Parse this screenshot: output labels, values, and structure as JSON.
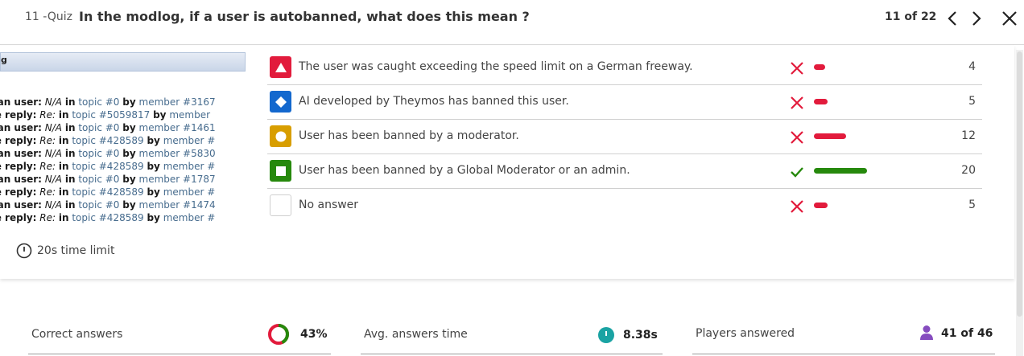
{
  "header": {
    "quiz_label": "11 -Quiz",
    "question": "In the modlog, if a user is autobanned, what does this mean ?",
    "counter": "11 of 22"
  },
  "modlog": {
    "header_text": "g",
    "lines": [
      {
        "action": "ban user:",
        "subject": "N/A",
        "mid": "in",
        "topic": "topic #0",
        "by": "by",
        "member": "member #3167"
      },
      {
        "action": "te reply:",
        "subject": "Re:",
        "mid": "in",
        "topic": "topic #5059817",
        "by": "by",
        "member": "member"
      },
      {
        "action": "ban user:",
        "subject": "N/A",
        "mid": "in",
        "topic": "topic #0",
        "by": "by",
        "member": "member #1461"
      },
      {
        "action": "te reply:",
        "subject": "Re:",
        "mid": "in",
        "topic": "topic #428589",
        "by": "by",
        "member": "member #"
      },
      {
        "action": "ban user:",
        "subject": "N/A",
        "mid": "in",
        "topic": "topic #0",
        "by": "by",
        "member": "member #5830"
      },
      {
        "action": "te reply:",
        "subject": "Re:",
        "mid": "in",
        "topic": "topic #428589",
        "by": "by",
        "member": "member #"
      },
      {
        "action": "ban user:",
        "subject": "N/A",
        "mid": "in",
        "topic": "topic #0",
        "by": "by",
        "member": "member #1787"
      },
      {
        "action": "te reply:",
        "subject": "Re:",
        "mid": "in",
        "topic": "topic #428589",
        "by": "by",
        "member": "member #"
      },
      {
        "action": "ban user:",
        "subject": "N/A",
        "mid": "in",
        "topic": "topic #0",
        "by": "by",
        "member": "member #1474"
      },
      {
        "action": "te reply:",
        "subject": "Re:",
        "mid": "in",
        "topic": "topic #428589",
        "by": "by",
        "member": "member #"
      }
    ]
  },
  "time_limit": "20s time limit",
  "answers": [
    {
      "shape": "triangle",
      "color": "#e21b3c",
      "text": "The user was caught exceeding the speed limit on a German freeway.",
      "correct": false,
      "count": "4",
      "share": 0.09
    },
    {
      "shape": "diamond",
      "color": "#1368ce",
      "text": "AI developed by Theymos has banned this user.",
      "correct": false,
      "count": "5",
      "share": 0.11
    },
    {
      "shape": "circle",
      "color": "#d89e00",
      "text": "User has been banned by a moderator.",
      "correct": false,
      "count": "12",
      "share": 0.26
    },
    {
      "shape": "square",
      "color": "#26890c",
      "text": "User has been banned by a Global Moderator or an admin.",
      "correct": true,
      "count": "20",
      "share": 0.43
    },
    {
      "shape": "none",
      "color": "#ffffff",
      "text": "No answer",
      "correct": false,
      "count": "5",
      "share": 0.11
    }
  ],
  "colors": {
    "wrong": "#e21b3c",
    "right": "#26890c",
    "timer": "#1aa3a3",
    "player": "#864cbf"
  },
  "stats": {
    "correct_label": "Correct answers",
    "correct_value": "43%",
    "correct_fraction": 0.43,
    "avg_label": "Avg. answers time",
    "avg_value": "8.38s",
    "players_label": "Players answered",
    "players_value": "41 of 46"
  }
}
